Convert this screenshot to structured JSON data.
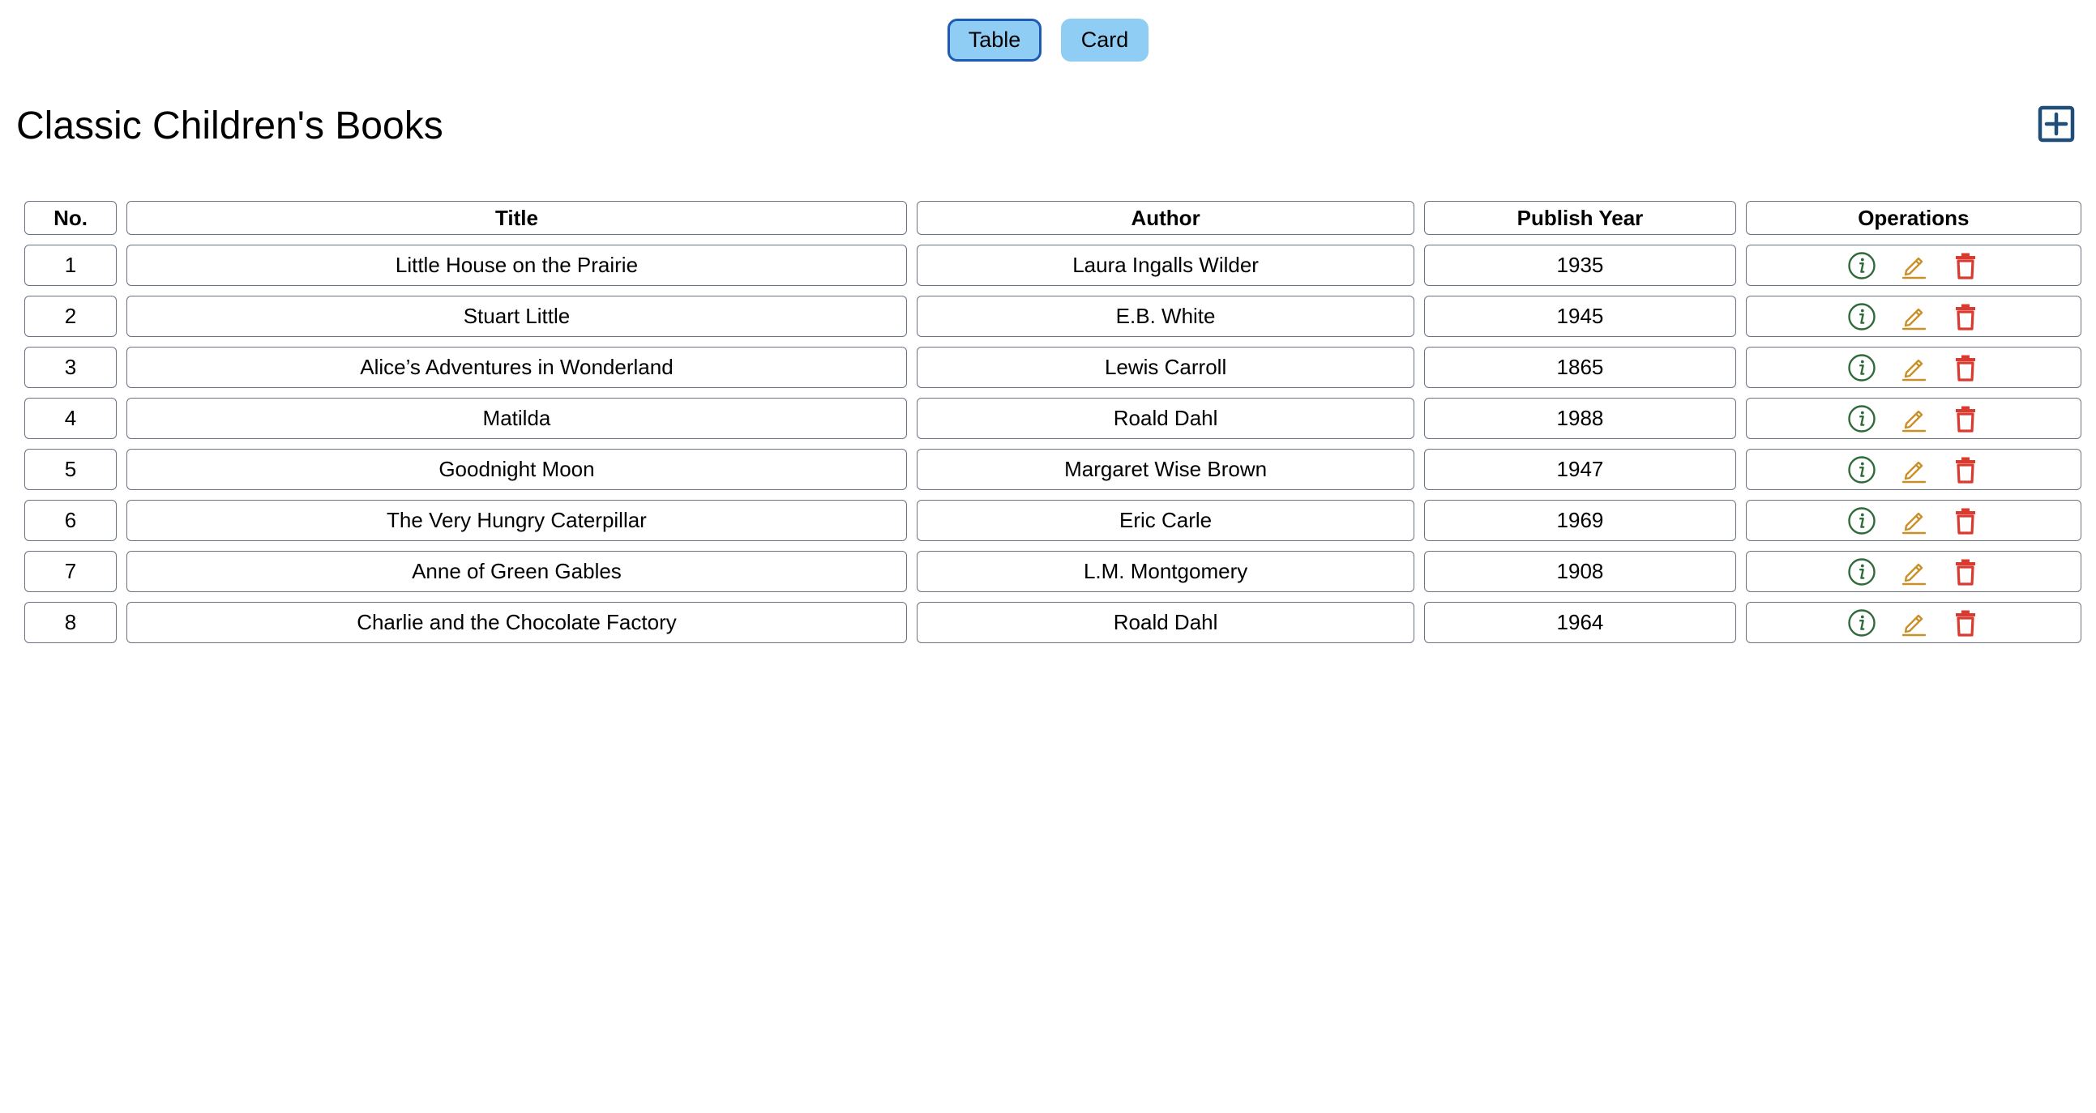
{
  "view_toggle": {
    "table_label": "Table",
    "card_label": "Card"
  },
  "header": {
    "title": "Classic Children's Books",
    "add_icon": "plus-square-icon"
  },
  "table": {
    "columns": [
      "No.",
      "Title",
      "Author",
      "Publish Year",
      "Operations"
    ],
    "rows": [
      {
        "no": "1",
        "title": "Little House on the Prairie",
        "author": "Laura Ingalls Wilder",
        "year": "1935"
      },
      {
        "no": "2",
        "title": "Stuart Little",
        "author": "E.B. White",
        "year": "1945"
      },
      {
        "no": "3",
        "title": "Alice’s Adventures in Wonderland",
        "author": "Lewis Carroll",
        "year": "1865"
      },
      {
        "no": "4",
        "title": "Matilda",
        "author": "Roald Dahl",
        "year": "1988"
      },
      {
        "no": "5",
        "title": "Goodnight Moon",
        "author": "Margaret Wise Brown",
        "year": "1947"
      },
      {
        "no": "6",
        "title": "The Very Hungry Caterpillar",
        "author": "Eric Carle",
        "year": "1969"
      },
      {
        "no": "7",
        "title": "Anne of Green Gables",
        "author": "L.M. Montgomery",
        "year": "1908"
      },
      {
        "no": "8",
        "title": "Charlie and the Chocolate Factory",
        "author": "Roald Dahl",
        "year": "1964"
      }
    ],
    "operation_icons": [
      "info-circle-icon",
      "pencil-edit-icon",
      "trash-icon"
    ]
  },
  "colors": {
    "toggle_bg": "#90cdf4",
    "toggle_active_border": "#1e5bb8",
    "add_icon": "#1f4e79",
    "info_icon": "#2f6b3a",
    "edit_icon": "#c9902a",
    "delete_icon": "#d93b30",
    "cell_border": "#6b7280"
  }
}
